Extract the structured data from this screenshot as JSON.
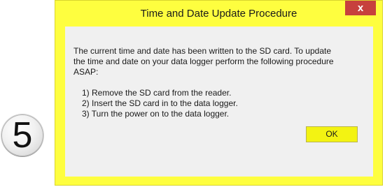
{
  "badge": {
    "number": "5"
  },
  "dialog": {
    "title": "Time and Date Update Procedure",
    "close_label": "x",
    "message_lines": [
      "The current time and date has been written to the SD card.  To update",
      "the time and date on your data logger perform the following procedure",
      "ASAP:"
    ],
    "steps": [
      "1) Remove the SD card from the reader.",
      "2) Insert the SD card in to the data logger.",
      "3) Turn the power on to the data logger."
    ],
    "ok_label": "OK"
  },
  "colors": {
    "dialog_frame": "#fefe3f",
    "close_button": "#c7413d",
    "client_area": "#f0f0f0",
    "ok_button": "#f3f312"
  }
}
